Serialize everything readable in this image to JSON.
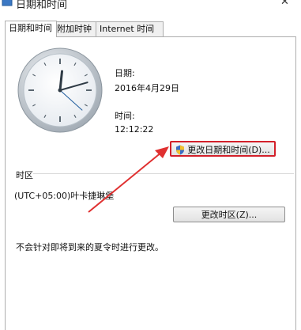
{
  "window": {
    "title": "日期和时间",
    "close_glyph": "✕"
  },
  "tabs": [
    {
      "label": "日期和时间",
      "active": true
    },
    {
      "label": "附加时钟",
      "active": false
    },
    {
      "label": "Internet 时间",
      "active": false
    }
  ],
  "date": {
    "label": "日期:",
    "value": "2016年4月29日"
  },
  "time": {
    "label": "时间:",
    "value": "12:12:22"
  },
  "clock": {
    "hour": 12,
    "minute": 12,
    "second": 22
  },
  "buttons": {
    "change_datetime": "更改日期和时间(D)...",
    "change_timezone": "更改时区(Z)..."
  },
  "timezone": {
    "section_label": "时区",
    "value": "(UTC+05:00)叶卡捷琳堡"
  },
  "dst_note": "不会针对即将到来的夏令时进行更改。",
  "colors": {
    "highlight": "#d3202a",
    "arrow": "#e03030"
  },
  "icons": {
    "app": "clock-calendar-icon",
    "shield": "uac-shield-icon",
    "close": "close-icon"
  }
}
